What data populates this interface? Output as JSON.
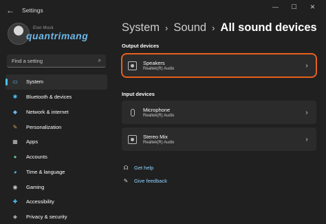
{
  "window": {
    "title": "Settings",
    "back_glyph": "←",
    "minimize_glyph": "—",
    "maximize_glyph": "☐",
    "close_glyph": "✕"
  },
  "profile": {
    "name": "Elon Musk",
    "watermark": "quantrimang"
  },
  "search": {
    "placeholder": "Find a setting",
    "icon": "search-icon"
  },
  "sidebar": {
    "accent_color": "#4cc2ff",
    "items": [
      {
        "label": "System",
        "icon": "monitor-icon",
        "glyph": "▭",
        "color": "#4cc2ff",
        "active": true
      },
      {
        "label": "Bluetooth & devices",
        "icon": "bluetooth-icon",
        "glyph": "✱",
        "color": "#4cc2ff"
      },
      {
        "label": "Network & internet",
        "icon": "wifi-icon",
        "glyph": "◆",
        "color": "#6bb6f0"
      },
      {
        "label": "Personalization",
        "icon": "brush-icon",
        "glyph": "✎",
        "color": "#e0a060"
      },
      {
        "label": "Apps",
        "icon": "apps-icon",
        "glyph": "▦",
        "color": "#c8c8c8"
      },
      {
        "label": "Accounts",
        "icon": "person-icon",
        "glyph": "●",
        "color": "#5ec48a"
      },
      {
        "label": "Time & language",
        "icon": "globe-clock-icon",
        "glyph": "◕",
        "color": "#4cc2ff"
      },
      {
        "label": "Gaming",
        "icon": "gamepad-icon",
        "glyph": "◉",
        "color": "#c8c8c8"
      },
      {
        "label": "Accessibility",
        "icon": "accessibility-icon",
        "glyph": "✚",
        "color": "#4cc2ff"
      },
      {
        "label": "Privacy & security",
        "icon": "shield-icon",
        "glyph": "◈",
        "color": "#c8c8c8"
      }
    ]
  },
  "breadcrumb": {
    "items": [
      "System",
      "Sound",
      "All sound devices"
    ],
    "separator": "›"
  },
  "output": {
    "heading": "Output devices",
    "devices": [
      {
        "name": "Speakers",
        "driver": "Realtek(R) Audio",
        "highlighted": true,
        "highlight_color": "#e8601c"
      }
    ]
  },
  "input": {
    "heading": "Input devices",
    "devices": [
      {
        "name": "Microphone",
        "driver": "Realtek(R) Audio"
      },
      {
        "name": "Stereo Mix",
        "driver": "Realtek(R) Audio"
      }
    ]
  },
  "help": {
    "get_help": "Get help",
    "give_feedback": "Give feedback",
    "link_color": "#8fd3ff"
  }
}
